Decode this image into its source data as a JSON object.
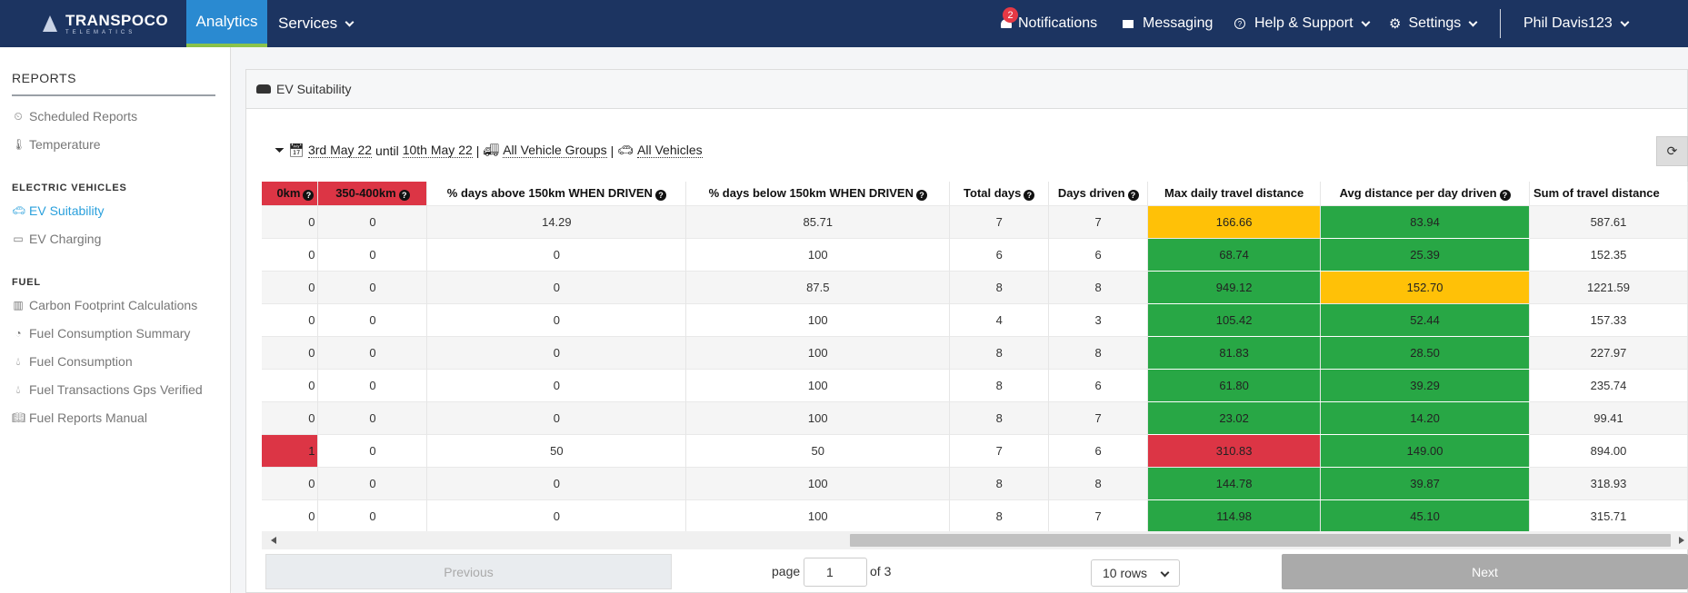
{
  "topbar": {
    "logo_brand": "TRANSPOCO",
    "logo_sub": "TELEMATICS",
    "tabs": [
      {
        "label": "Analytics",
        "active": true
      },
      {
        "label": "Services"
      }
    ],
    "notifications_label": "Notifications",
    "notifications_count": "2",
    "messaging_label": "Messaging",
    "help_label": "Help & Support",
    "settings_label": "Settings",
    "user_label": "Phil Davis123",
    "bar_color": "#1c3461",
    "active_tab_color": "#2a8ad1"
  },
  "sidebar": {
    "title": "REPORTS",
    "items_top": [
      {
        "label": "Scheduled Reports",
        "icon": "clock-icon"
      },
      {
        "label": "Temperature",
        "icon": "thermometer-icon"
      }
    ],
    "section_ev": "ELECTRIC VEHICLES",
    "items_ev": [
      {
        "label": "EV Suitability",
        "icon": "car-icon",
        "active": true
      },
      {
        "label": "EV Charging",
        "icon": "battery-icon"
      }
    ],
    "section_fuel": "FUEL",
    "items_fuel": [
      {
        "label": "Carbon Footprint Calculations",
        "icon": "bar-chart-icon"
      },
      {
        "label": "Fuel Consumption Summary",
        "icon": "dashboard-icon"
      },
      {
        "label": "Fuel Consumption",
        "icon": "tint-icon"
      },
      {
        "label": "Fuel Transactions Gps Verified",
        "icon": "tint-icon"
      },
      {
        "label": "Fuel Reports Manual",
        "icon": "book-icon"
      }
    ]
  },
  "panel": {
    "title": "EV Suitability",
    "filter": {
      "date_from": "3rd May 22",
      "until": "until",
      "date_to": "10th May 22",
      "sep": "|",
      "groups": "All Vehicle Groups",
      "vehicles": "All Vehicles"
    }
  },
  "table": {
    "headers": [
      "0km",
      "350-400km",
      "% days above 150km WHEN DRIVEN",
      "% days below 150km WHEN DRIVEN",
      "Total days",
      "Days driven",
      "Max daily travel distance",
      "Avg distance per day driven",
      "Sum of travel distance"
    ],
    "rows": [
      {
        "c0": "0",
        "c1": "0",
        "above": "14.29",
        "below": "85.71",
        "total": "7",
        "driven": "7",
        "max": "166.66",
        "avg": "83.94",
        "sum": "587.61",
        "max_status": "warn",
        "avg_status": "ok",
        "c0_status": ""
      },
      {
        "c0": "0",
        "c1": "0",
        "above": "0",
        "below": "100",
        "total": "6",
        "driven": "6",
        "max": "68.74",
        "avg": "25.39",
        "sum": "152.35",
        "max_status": "ok",
        "avg_status": "ok",
        "c0_status": ""
      },
      {
        "c0": "0",
        "c1": "0",
        "above": "0",
        "below": "87.5",
        "total": "8",
        "driven": "8",
        "max": "949.12",
        "avg": "152.70",
        "sum": "1221.59",
        "max_status": "ok",
        "avg_status": "warn",
        "c0_status": ""
      },
      {
        "c0": "0",
        "c1": "0",
        "above": "0",
        "below": "100",
        "total": "4",
        "driven": "3",
        "max": "105.42",
        "avg": "52.44",
        "sum": "157.33",
        "max_status": "ok",
        "avg_status": "ok",
        "c0_status": ""
      },
      {
        "c0": "0",
        "c1": "0",
        "above": "0",
        "below": "100",
        "total": "8",
        "driven": "8",
        "max": "81.83",
        "avg": "28.50",
        "sum": "227.97",
        "max_status": "ok",
        "avg_status": "ok",
        "c0_status": ""
      },
      {
        "c0": "0",
        "c1": "0",
        "above": "0",
        "below": "100",
        "total": "8",
        "driven": "6",
        "max": "61.80",
        "avg": "39.29",
        "sum": "235.74",
        "max_status": "ok",
        "avg_status": "ok",
        "c0_status": ""
      },
      {
        "c0": "0",
        "c1": "0",
        "above": "0",
        "below": "100",
        "total": "8",
        "driven": "7",
        "max": "23.02",
        "avg": "14.20",
        "sum": "99.41",
        "max_status": "ok",
        "avg_status": "ok",
        "c0_status": ""
      },
      {
        "c0": "1",
        "c1": "0",
        "above": "50",
        "below": "50",
        "total": "7",
        "driven": "6",
        "max": "310.83",
        "avg": "149.00",
        "sum": "894.00",
        "max_status": "bad",
        "avg_status": "ok",
        "c0_status": "bad"
      },
      {
        "c0": "0",
        "c1": "0",
        "above": "0",
        "below": "100",
        "total": "8",
        "driven": "8",
        "max": "144.78",
        "avg": "39.87",
        "sum": "318.93",
        "max_status": "ok",
        "avg_status": "ok",
        "c0_status": ""
      },
      {
        "c0": "0",
        "c1": "0",
        "above": "0",
        "below": "100",
        "total": "8",
        "driven": "7",
        "max": "114.98",
        "avg": "45.10",
        "sum": "315.71",
        "max_status": "ok",
        "avg_status": "ok",
        "c0_status": ""
      }
    ],
    "status_colors": {
      "ok": "#28a745",
      "warn": "#ffc107",
      "bad": "#dc3545"
    }
  },
  "pagination": {
    "previous_label": "Previous",
    "page_label": "page",
    "page_value": "1",
    "of_label": "of 3",
    "rows_label": "10 rows",
    "next_label": "Next"
  }
}
